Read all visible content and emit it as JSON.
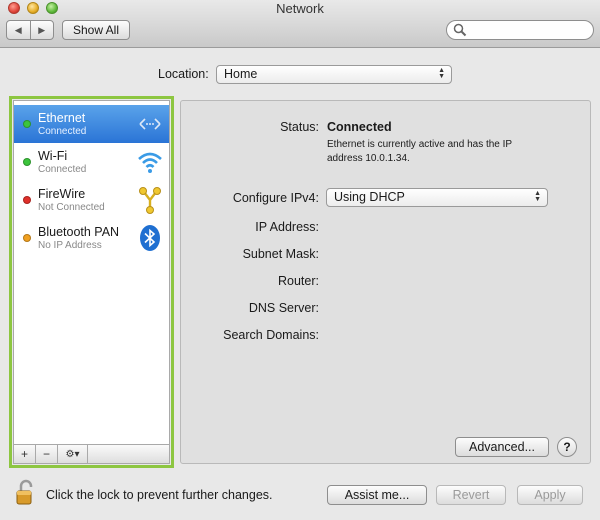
{
  "window": {
    "title": "Network"
  },
  "toolbar": {
    "show_all_label": "Show All",
    "search_placeholder": ""
  },
  "location": {
    "label": "Location:",
    "value": "Home"
  },
  "services": [
    {
      "name": "Ethernet",
      "status": "Connected",
      "dot_color": "#3cc43c",
      "icon": "ethernet-arrows-icon",
      "selected": true
    },
    {
      "name": "Wi-Fi",
      "status": "Connected",
      "dot_color": "#3cc43c",
      "icon": "wifi-icon",
      "selected": false
    },
    {
      "name": "FireWire",
      "status": "Not Connected",
      "dot_color": "#e0302a",
      "icon": "firewire-icon",
      "selected": false
    },
    {
      "name": "Bluetooth PAN",
      "status": "No IP Address",
      "dot_color": "#f0a020",
      "icon": "bluetooth-icon",
      "selected": false
    }
  ],
  "sidebar_controls": {
    "add": "+",
    "remove": "−",
    "action": "⚙▾"
  },
  "detail": {
    "status_label": "Status:",
    "status_value": "Connected",
    "status_desc": "Ethernet is currently active and has the IP address 10.0.1.34.",
    "configure_label": "Configure IPv4:",
    "configure_value": "Using DHCP",
    "ip_label": "IP Address:",
    "subnet_label": "Subnet Mask:",
    "router_label": "Router:",
    "dns_label": "DNS Server:",
    "search_domains_label": "Search Domains:",
    "advanced_label": "Advanced...",
    "help_label": "?"
  },
  "footer": {
    "lock_text": "Click the lock to prevent further changes.",
    "assist_label": "Assist me...",
    "revert_label": "Revert",
    "apply_label": "Apply"
  },
  "colors": {
    "selection": "#2a74d6",
    "highlight_outline": "#8dc641"
  }
}
